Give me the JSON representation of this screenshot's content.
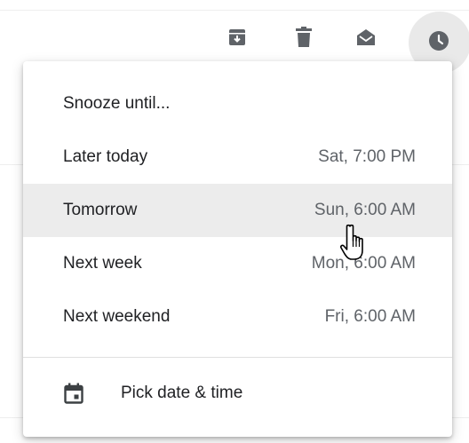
{
  "toolbar": {
    "icons": [
      "archive-icon",
      "delete-icon",
      "mark-as-read-icon",
      "snooze-icon"
    ]
  },
  "menu": {
    "title": "Snooze until...",
    "items": [
      {
        "label": "Later today",
        "time": "Sat, 7:00 PM"
      },
      {
        "label": "Tomorrow",
        "time": "Sun, 6:00 AM",
        "highlighted": true
      },
      {
        "label": "Next week",
        "time": "Mon, 6:00 AM"
      },
      {
        "label": "Next weekend",
        "time": "Fri, 6:00 AM"
      }
    ],
    "pick_label": "Pick date & time",
    "pick_icon": "calendar-icon"
  },
  "colors": {
    "icon": "#5f6368",
    "text": "#202124",
    "time": "#5f6368",
    "highlight": "#ececec",
    "snooze_active_bg": "#e9e9e9"
  }
}
